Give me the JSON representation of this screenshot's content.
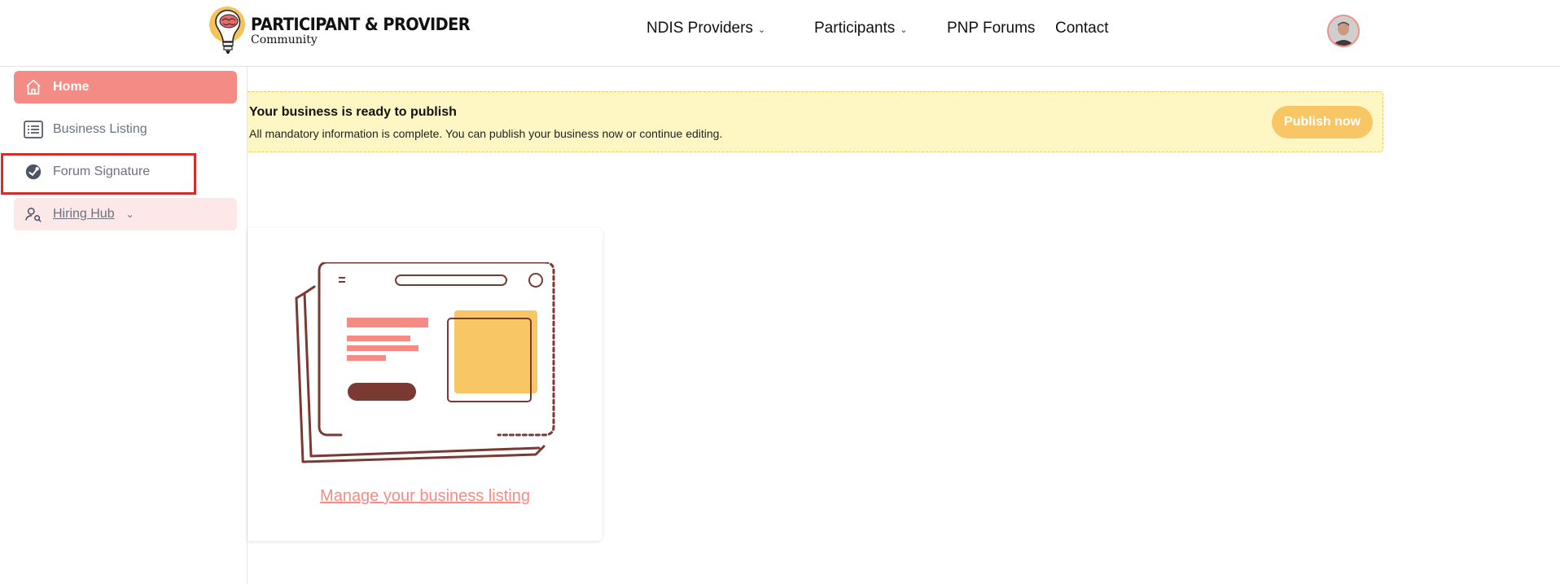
{
  "brand": {
    "title": "PARTICIPANT & PROVIDER",
    "subtitle": "Community"
  },
  "nav": {
    "items": [
      {
        "label": "NDIS Providers",
        "dropdown": true
      },
      {
        "label": "Participants",
        "dropdown": true
      },
      {
        "label": "PNP Forums",
        "dropdown": false
      },
      {
        "label": "Contact",
        "dropdown": false
      }
    ]
  },
  "sidebar": {
    "items": [
      {
        "label": "Home",
        "icon": "home-icon",
        "active": true
      },
      {
        "label": "Business Listing",
        "icon": "list-icon",
        "active": false
      },
      {
        "label": "Forum Signature",
        "icon": "signature-icon",
        "active": false
      },
      {
        "label": "Hiring Hub",
        "icon": "user-search-icon",
        "active": false,
        "expandable": true
      }
    ]
  },
  "banner": {
    "title": "Your business is ready to publish",
    "description": "All mandatory information is complete. You can publish your business now or continue editing.",
    "button_label": "Publish now"
  },
  "card": {
    "link_label": "Manage your business listing"
  },
  "colors": {
    "accent": "#f48b84",
    "banner_bg": "#fef7c3",
    "publish_button": "#f8c664",
    "illustration_dark": "#7a3a33",
    "highlight": "#d62c2c"
  }
}
